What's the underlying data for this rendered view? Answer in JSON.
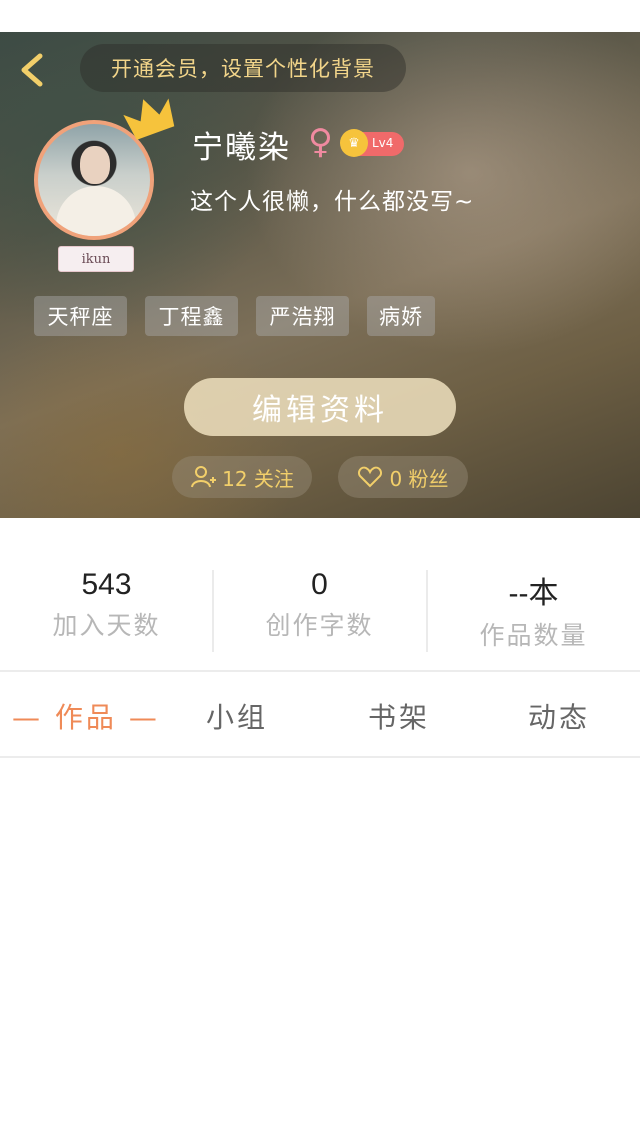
{
  "header": {
    "back_icon": "chevron-left-icon",
    "vip_banner": "开通会员，设置个性化背景"
  },
  "profile": {
    "name": "宁曦染",
    "gender_symbol": "♀",
    "level": "Lv4",
    "bio": "这个人很懒，什么都没写~",
    "avatar_tag": "ikun",
    "tags": [
      "天秤座",
      "丁程鑫",
      "严浩翔",
      "病娇"
    ],
    "edit_button": "编辑资料",
    "following": "12 关注",
    "followers": "0 粉丝"
  },
  "stats": [
    {
      "value": "543",
      "label": "加入天数"
    },
    {
      "value": "0",
      "label": "创作字数"
    },
    {
      "value": "--本",
      "label": "作品数量"
    }
  ],
  "tabs": [
    {
      "label": "作品",
      "active": true
    },
    {
      "label": "小组",
      "active": false
    },
    {
      "label": "书架",
      "active": false
    },
    {
      "label": "动态",
      "active": false
    }
  ],
  "colors": {
    "accent": "#ef8a57",
    "gold": "#f2cf6a",
    "level_badge": "#f06a6a"
  }
}
